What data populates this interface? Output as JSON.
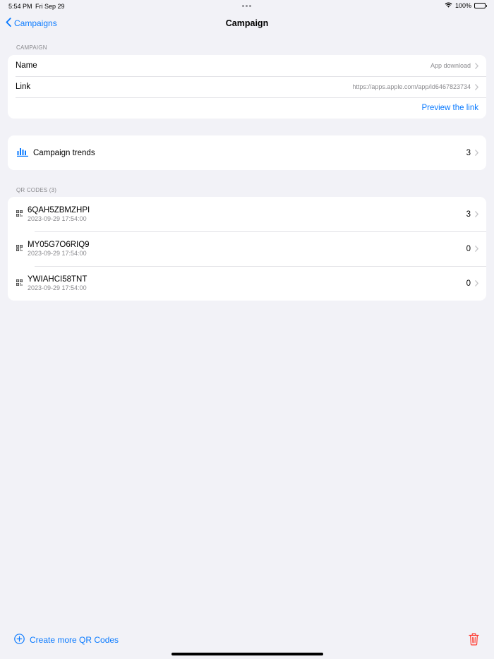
{
  "status_bar": {
    "time": "5:54 PM",
    "date": "Fri Sep 29",
    "battery": "100%"
  },
  "nav": {
    "back_label": "Campaigns",
    "title": "Campaign"
  },
  "campaign_section": {
    "header": "CAMPAIGN",
    "name_label": "Name",
    "name_value": "App download",
    "link_label": "Link",
    "link_value": "https://apps.apple.com/app/id6467823734",
    "preview_label": "Preview the link"
  },
  "trends": {
    "label": "Campaign trends",
    "count": "3"
  },
  "qr_section": {
    "header": "QR CODES (3)",
    "items": [
      {
        "code": "6QAH5ZBMZHPI",
        "date": "2023-09-29 17:54:00",
        "count": "3"
      },
      {
        "code": "MY05G7O6RIQ9",
        "date": "2023-09-29 17:54:00",
        "count": "0"
      },
      {
        "code": "YWIAHCI58TNT",
        "date": "2023-09-29 17:54:00",
        "count": "0"
      }
    ]
  },
  "toolbar": {
    "create_label": "Create more QR Codes"
  },
  "colors": {
    "accent": "#0a7aff",
    "destructive": "#ff3b30",
    "background": "#f2f2f7",
    "secondary_text": "#8a8a8e"
  },
  "icons": [
    "chevron-left-icon",
    "wifi-icon",
    "battery-icon",
    "bar-chart-icon",
    "qr-code-icon",
    "chevron-right-icon",
    "plus-circle-icon",
    "trash-icon"
  ]
}
